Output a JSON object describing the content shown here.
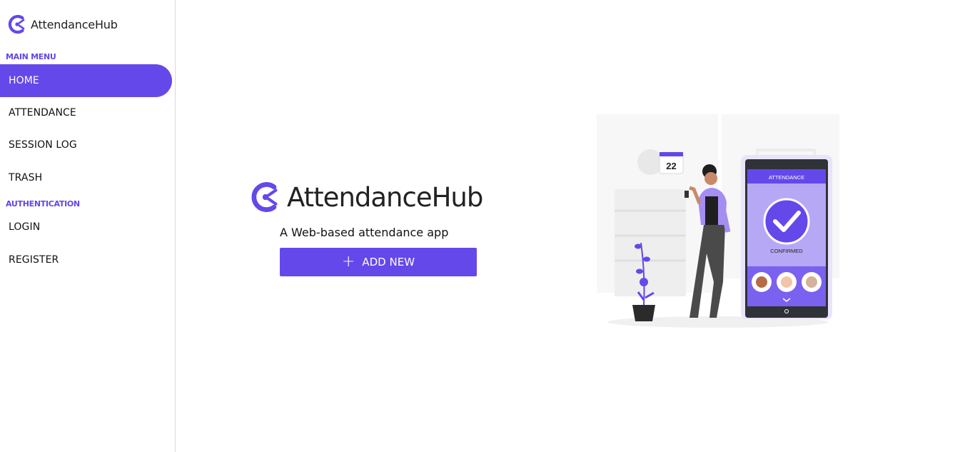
{
  "app": {
    "brand_name": "AttendanceHub",
    "accent_color": "#6548ea"
  },
  "sidebar": {
    "sections": [
      {
        "label": "MAIN MENU"
      },
      {
        "label": "AUTHENTICATION"
      }
    ],
    "items": [
      {
        "label": "HOME",
        "active": true
      },
      {
        "label": "ATTENDANCE",
        "active": false
      },
      {
        "label": "SESSION LOG",
        "active": false
      },
      {
        "label": "TRASH",
        "active": false
      },
      {
        "label": "LOGIN",
        "active": false
      },
      {
        "label": "REGISTER",
        "active": false
      }
    ]
  },
  "hero": {
    "brand_name": "AttendanceHub",
    "tagline": "A Web-based attendance app",
    "add_button_label": "ADD NEW",
    "add_button_icon": "plus-icon"
  },
  "illustration": {
    "calendar_day": "22",
    "phone_header": "ATTENDANCE",
    "status_label": "CONFIRMED"
  }
}
